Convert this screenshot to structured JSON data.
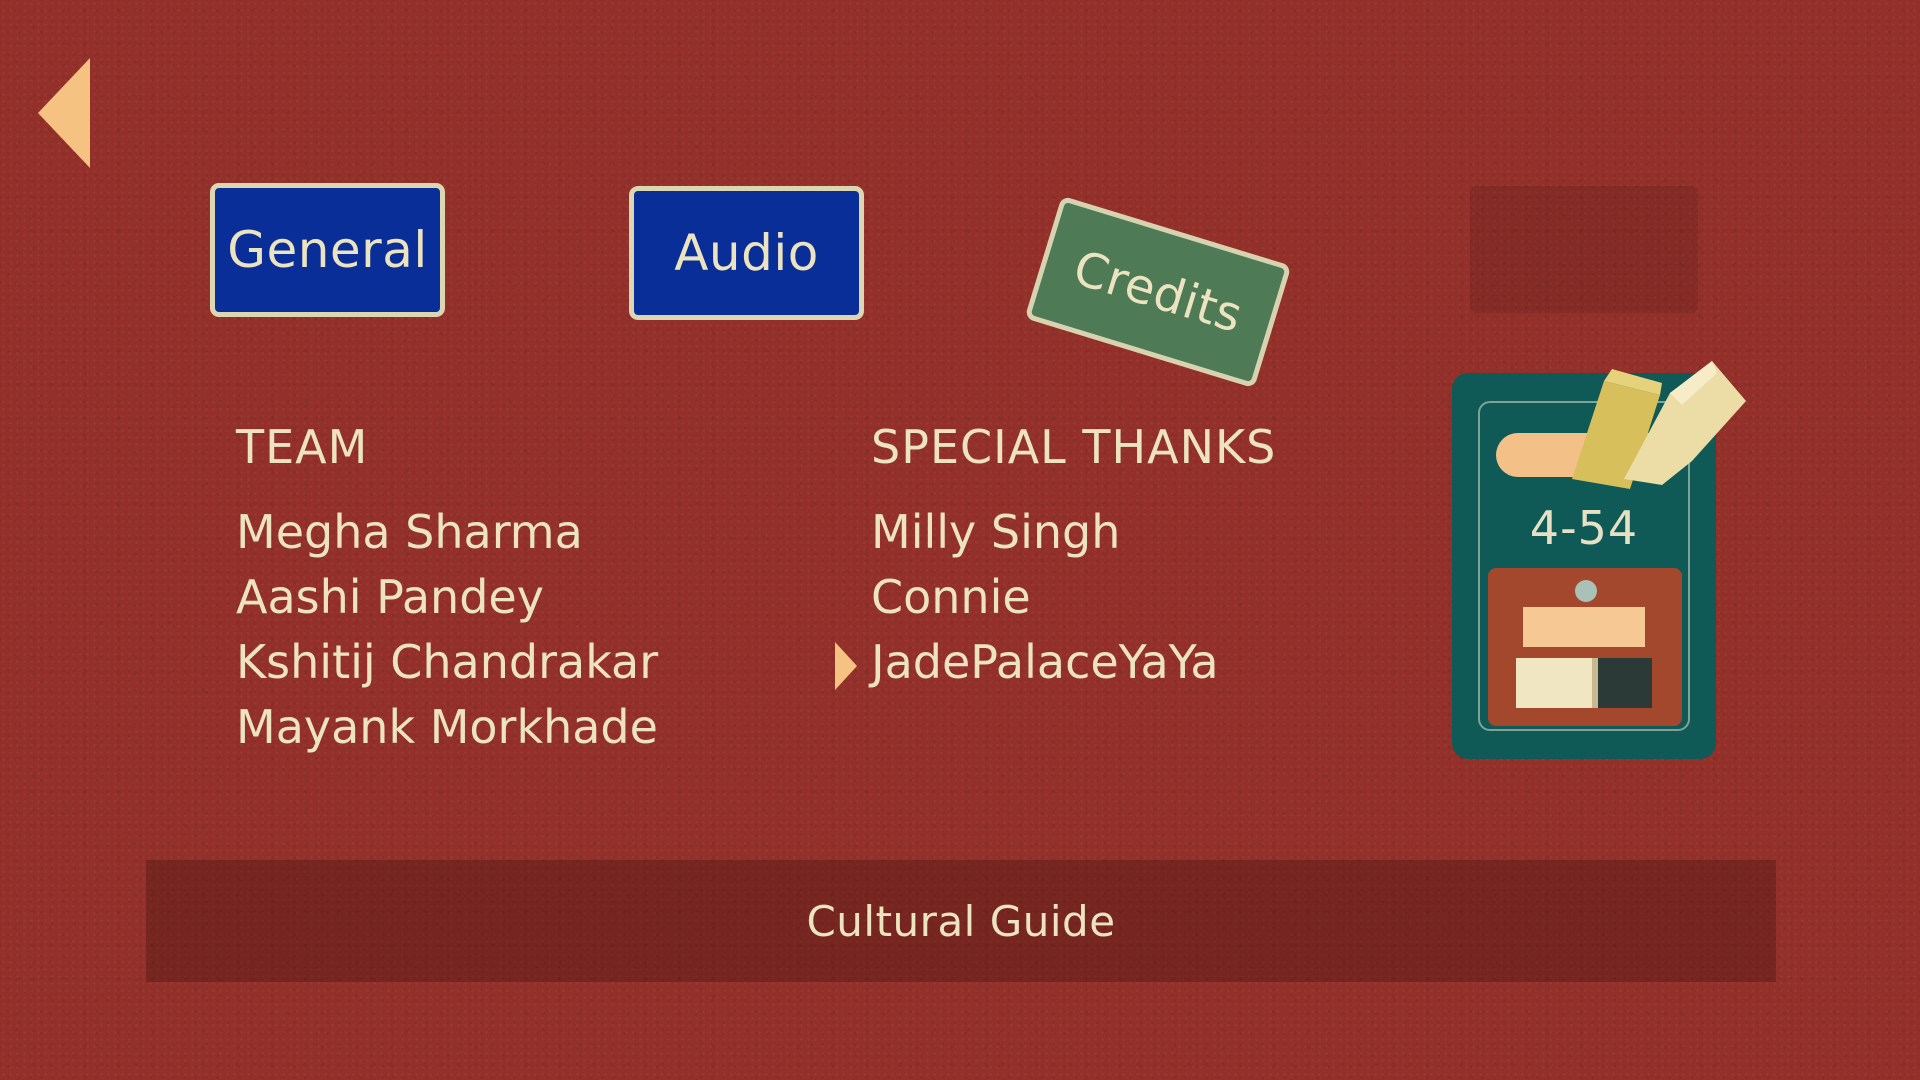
{
  "navigation": {
    "back_icon": "chevron-left-icon"
  },
  "tabs": {
    "general": "General",
    "audio": "Audio",
    "credits": "Credits",
    "active": "Credits"
  },
  "credits": {
    "team": {
      "heading": "TEAM",
      "members": [
        "Megha Sharma",
        "Aashi Pandey",
        "Kshitij Chandrakar",
        "Mayank Morkhade"
      ]
    },
    "special_thanks": {
      "heading": "SPECIAL THANKS",
      "members": [
        "Milly Singh",
        "Connie",
        "JadePalaceYaYa"
      ],
      "selected_index": 2
    }
  },
  "pass_card": {
    "number": "4-54",
    "icon": "ticket-machine-icon"
  },
  "footer": {
    "cultural_guide_label": "Cultural Guide"
  },
  "colors": {
    "background": "#93302a",
    "text": "#ece3c0",
    "tab_blue": "#0a2e98",
    "tab_green": "#4e7a55",
    "accent_arrow": "#f6c281",
    "card_teal": "#0f5957"
  }
}
